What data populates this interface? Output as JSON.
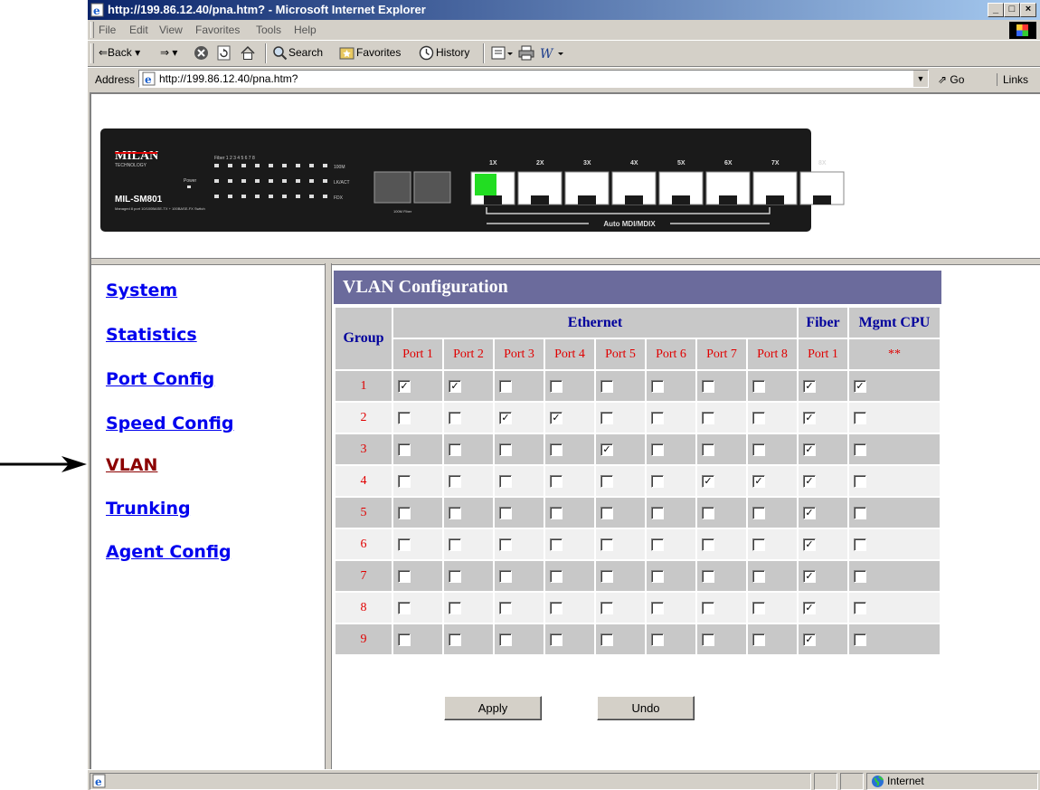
{
  "window": {
    "title": "http://199.86.12.40/pna.htm? - Microsoft Internet Explorer",
    "buttons": {
      "minimize": "_",
      "maximize": "□",
      "close": "×"
    }
  },
  "menubar": [
    "File",
    "Edit",
    "View",
    "Favorites",
    "Tools",
    "Help"
  ],
  "toolbar": {
    "back": "⇐Back ▾",
    "forward": "⇒ ▾",
    "search": "Search",
    "favorites": "Favorites",
    "history": "History"
  },
  "address": {
    "label": "Address",
    "url": "http://199.86.12.40/pna.htm?",
    "go": "Go",
    "links": "Links"
  },
  "banner": {
    "brand": "MILAN",
    "brand_sub": "TECHNOLOGY",
    "model": "MIL-SM801",
    "description": "Managed 8 port 10/100BASE-TX + 100BASE-FX Switch",
    "led_header": "Fiber 1  2  3  4  5  6  7  8",
    "led_rows": [
      "100M",
      "LK/ACT",
      "FDX"
    ],
    "power_label": "Power",
    "fiber_label": "100M Fiber",
    "port_labels": [
      "1X",
      "2X",
      "3X",
      "4X",
      "5X",
      "6X",
      "7X",
      "8X"
    ],
    "mdi_label": "Auto MDI/MDIX",
    "active_port": 1
  },
  "nav": {
    "items": [
      {
        "label": "System",
        "active": false
      },
      {
        "label": "Statistics",
        "active": false
      },
      {
        "label": "Port Config",
        "active": false
      },
      {
        "label": "Speed Config",
        "active": false
      },
      {
        "label": "VLAN",
        "active": true
      },
      {
        "label": "Trunking",
        "active": false
      },
      {
        "label": "Agent Config",
        "active": false
      }
    ]
  },
  "vlan": {
    "title": "VLAN Configuration",
    "group_header": "Group",
    "ethernet_header": "Ethernet",
    "fiber_header": "Fiber",
    "mgmt_header": "Mgmt CPU",
    "ethernet_ports": [
      "Port 1",
      "Port 2",
      "Port 3",
      "Port 4",
      "Port 5",
      "Port 6",
      "Port 7",
      "Port 8"
    ],
    "fiber_port": "Port 1",
    "mgmt_sub": "**",
    "rows": [
      {
        "group": "1",
        "eth": [
          true,
          true,
          false,
          false,
          false,
          false,
          false,
          false
        ],
        "fiber": true,
        "mgmt": true
      },
      {
        "group": "2",
        "eth": [
          false,
          false,
          true,
          true,
          false,
          false,
          false,
          false
        ],
        "fiber": true,
        "mgmt": false
      },
      {
        "group": "3",
        "eth": [
          false,
          false,
          false,
          false,
          true,
          false,
          false,
          false
        ],
        "fiber": true,
        "mgmt": false
      },
      {
        "group": "4",
        "eth": [
          false,
          false,
          false,
          false,
          false,
          false,
          true,
          true
        ],
        "fiber": true,
        "mgmt": false
      },
      {
        "group": "5",
        "eth": [
          false,
          false,
          false,
          false,
          false,
          false,
          false,
          false
        ],
        "fiber": true,
        "mgmt": false
      },
      {
        "group": "6",
        "eth": [
          false,
          false,
          false,
          false,
          false,
          false,
          false,
          false
        ],
        "fiber": true,
        "mgmt": false
      },
      {
        "group": "7",
        "eth": [
          false,
          false,
          false,
          false,
          false,
          false,
          false,
          false
        ],
        "fiber": true,
        "mgmt": false
      },
      {
        "group": "8",
        "eth": [
          false,
          false,
          false,
          false,
          false,
          false,
          false,
          false
        ],
        "fiber": true,
        "mgmt": false
      },
      {
        "group": "9",
        "eth": [
          false,
          false,
          false,
          false,
          false,
          false,
          false,
          false
        ],
        "fiber": true,
        "mgmt": false
      }
    ],
    "apply_label": "Apply",
    "undo_label": "Undo"
  },
  "status": {
    "zone": "Internet"
  },
  "colors": {
    "header_bg": "#6b6b9c",
    "header_text": "#00009c",
    "port_text": "#e00000",
    "link": "#0000ee",
    "link_active": "#8b0000",
    "active_port": "#22dd22"
  }
}
